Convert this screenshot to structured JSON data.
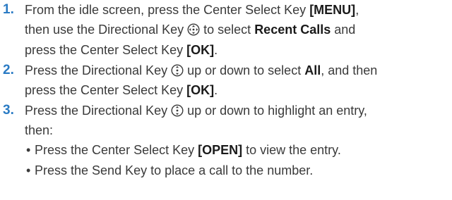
{
  "steps": [
    {
      "number": "1.",
      "line1": {
        "t1": "From the idle screen, press the Center Select Key ",
        "b1": "[MENU]",
        "t2": ","
      },
      "line2": {
        "t1": "then use the Directional Key ",
        "icon": "directional-key-4way-icon",
        "t2": " to select ",
        "b1": "Recent Calls",
        "t3": " and"
      },
      "line3": {
        "t1": "press the Center Select Key ",
        "b1": "[OK]",
        "t2": "."
      }
    },
    {
      "number": "2.",
      "line1": {
        "t1": "Press the Directional Key ",
        "icon": "directional-key-updown-icon",
        "t2": " up or down to select ",
        "b1": "All",
        "t3": ", and then"
      },
      "line2": {
        "t1": "press the Center Select Key ",
        "b1": "[OK]",
        "t2": "."
      }
    },
    {
      "number": "3.",
      "line1": {
        "t1": "Press the Directional Key ",
        "icon": "directional-key-updown-icon",
        "t2": " up or down to highlight an entry,"
      },
      "line2": {
        "t1": "then:"
      },
      "bullets": [
        {
          "t1": "Press the Center Select Key ",
          "b1": "[OPEN]",
          "t2": " to view the entry."
        },
        {
          "t1": "Press the Send Key to place a call to the number."
        }
      ]
    }
  ],
  "colors": {
    "step_number": "#2a7bc4",
    "body_text": "#3a3a3a",
    "bold_text": "#1a1a1a"
  }
}
